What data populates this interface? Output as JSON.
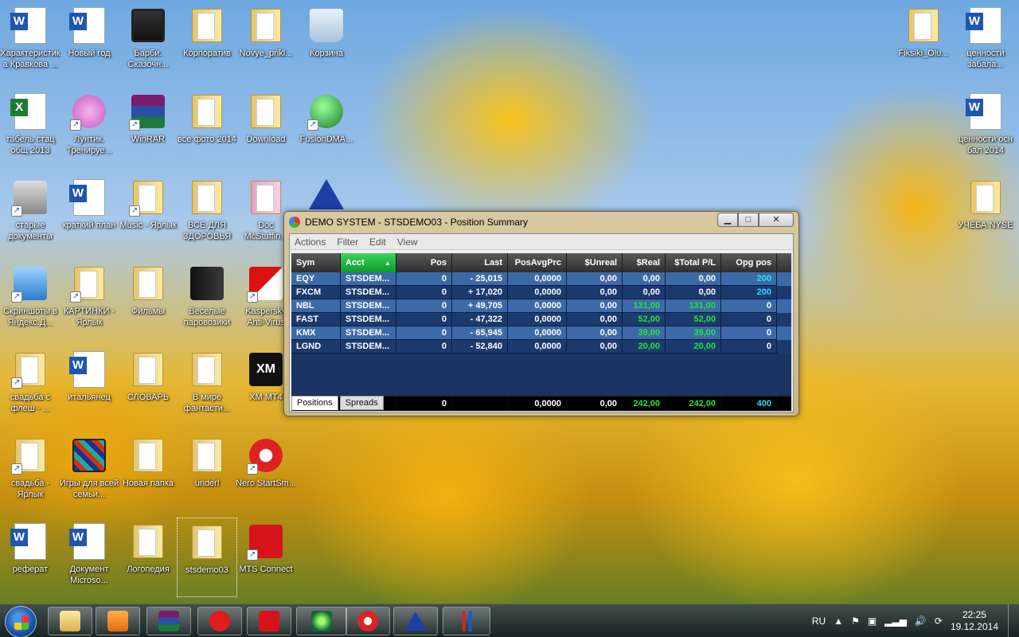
{
  "desktop_icons": {
    "c0": [
      "Характеристика Кравкова ...",
      "табель стац общ 2013",
      "старые документы",
      "Скриншоты в Яндекс.Д...",
      "свадьба с флеш - ...",
      "свадьба - Ярлык",
      "реферат"
    ],
    "c1": [
      "Новый год",
      "Лунтик. Тренируе...",
      "краткий план",
      "КАРТИНКИ - Ярлык",
      "итальянец",
      "Игры для всей семьи...",
      "Документ Microso..."
    ],
    "c2": [
      "Барби. Сказочн...",
      "WinRAR",
      "Music - Ярлык",
      "Фильмы",
      "СЛОВАРЬ",
      "Новая папка",
      "Логопедия"
    ],
    "c3": [
      "Корпоратив",
      "все фото 2014",
      "ВСЕ ДЛЯ ЗДОРОВЬЯ",
      "Веселые паровозики",
      "В мире фантасти...",
      "underl",
      "stsdemo03"
    ],
    "c4": [
      "Novye_prikl...",
      "Download",
      "Doc McStuffin...",
      "Kaspersky Anti-Virus",
      "XM MT4",
      "Nero StartSm...",
      "MTS Connect"
    ],
    "c5": [
      "Корзина",
      "FusionDMA..."
    ],
    "right": [
      "Fiksiki_Olu...",
      "ценности забала...",
      "ценности осн бал 2014",
      "УЧЕБА NYSE"
    ]
  },
  "window": {
    "title": "DEMO SYSTEM - STSDEMO03 - Position Summary",
    "menu": [
      "Actions",
      "Filter",
      "Edit",
      "View"
    ],
    "columns": [
      "Sym",
      "Acct",
      "Pos",
      "Last",
      "PosAvgPrc",
      "$Unreal",
      "$Real",
      "$Total P/L",
      "Opg pos"
    ],
    "rows": [
      [
        "EQY",
        "STSDEM...",
        "0",
        "- 25,015",
        "0,0000",
        "0,00",
        "0,00",
        "0,00",
        "200"
      ],
      [
        "FXCM",
        "STSDEM...",
        "0",
        "+ 17,020",
        "0,0000",
        "0,00",
        "0,00",
        "0,00",
        "200"
      ],
      [
        "NBL",
        "STSDEM...",
        "0",
        "+ 49,705",
        "0,0000",
        "0,00",
        "131,00",
        "131,00",
        "0"
      ],
      [
        "FAST",
        "STSDEM...",
        "0",
        "- 47,322",
        "0,0000",
        "0,00",
        "52,00",
        "52,00",
        "0"
      ],
      [
        "KMX",
        "STSDEM...",
        "0",
        "- 65,945",
        "0,0000",
        "0,00",
        "39,00",
        "39,00",
        "0"
      ],
      [
        "LGND",
        "STSDEM...",
        "0",
        "- 52,840",
        "0,0000",
        "0,00",
        "20,00",
        "20,00",
        "0"
      ]
    ],
    "totals": [
      "",
      "",
      "0",
      "",
      "0,0000",
      "0,00",
      "242,00",
      "242,00",
      "400"
    ],
    "tabs": [
      "Positions",
      "Spreads"
    ]
  },
  "taskbar": {
    "lang": "RU",
    "time": "22:25",
    "date": "19.12.2014"
  },
  "colors": {
    "gain": "#22e43a",
    "opg": "#2fd8ff"
  }
}
